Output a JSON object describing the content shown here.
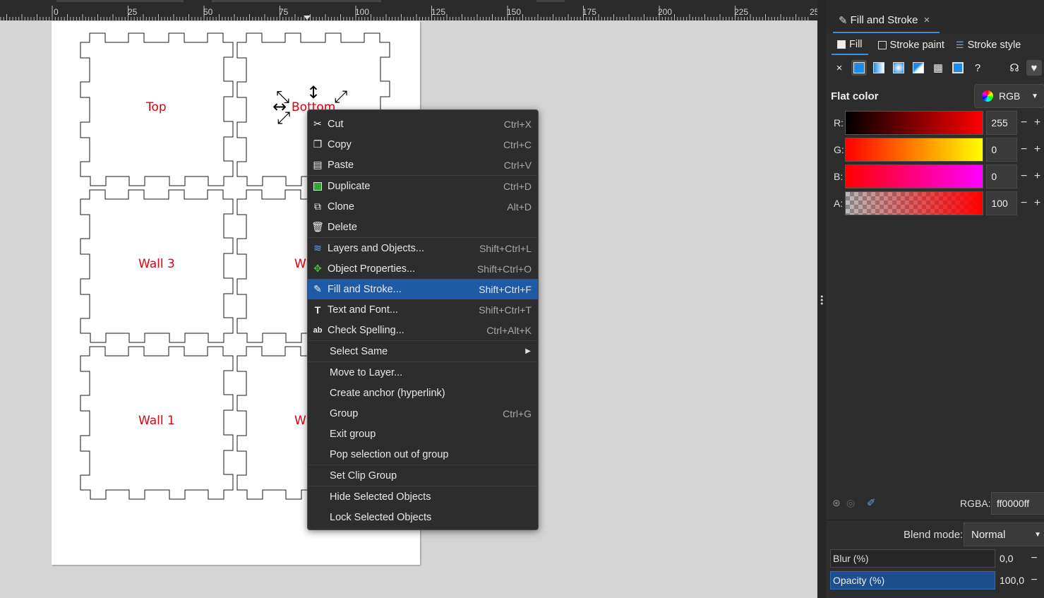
{
  "ruler": {
    "labels": [
      "0",
      "25",
      "50",
      "75",
      "100",
      "125",
      "150",
      "175",
      "200",
      "225",
      "25"
    ]
  },
  "canvas": {
    "labels": {
      "top": "Top",
      "bottom": "Bottom",
      "wall3": "Wall 3",
      "wall4_partial": "W",
      "wall1": "Wall 1",
      "wall2_partial": "W"
    }
  },
  "panel": {
    "tab_title": "Fill and Stroke",
    "tab_close": "×",
    "subtabs": {
      "fill": "Fill",
      "stroke_paint": "Stroke paint",
      "stroke_style": "Stroke style"
    },
    "modes": {
      "none": "×",
      "unknown": "?"
    },
    "flat_color": "Flat color",
    "color_model": "RGB",
    "channels": [
      {
        "name": "R:",
        "value": "255"
      },
      {
        "name": "G:",
        "value": "0"
      },
      {
        "name": "B:",
        "value": "0"
      },
      {
        "name": "A:",
        "value": "100"
      }
    ],
    "minus": "−",
    "plus": "+",
    "rgba_label": "RGBA:",
    "rgba_value": "ff0000ff",
    "blend_label": "Blend mode:",
    "blend_value": "Normal",
    "blur_label": "Blur (%)",
    "blur_value": "0,0",
    "opacity_label": "Opacity (%)",
    "opacity_value": "100,0",
    "colors": {
      "accent": "#3c8fd8",
      "selection": "#1f5aa6",
      "fill_red": "#ff0000"
    }
  },
  "context_menu": {
    "items": [
      {
        "label": "Cut",
        "shortcut": "Ctrl+X"
      },
      {
        "label": "Copy",
        "shortcut": "Ctrl+C"
      },
      {
        "label": "Paste",
        "shortcut": "Ctrl+V"
      },
      {
        "label": "Duplicate",
        "shortcut": "Ctrl+D"
      },
      {
        "label": "Clone",
        "shortcut": "Alt+D"
      },
      {
        "label": "Delete",
        "shortcut": ""
      },
      {
        "label": "Layers and Objects...",
        "shortcut": "Shift+Ctrl+L"
      },
      {
        "label": "Object Properties...",
        "shortcut": "Shift+Ctrl+O"
      },
      {
        "label": "Fill and Stroke...",
        "shortcut": "Shift+Ctrl+F"
      },
      {
        "label": "Text and Font...",
        "shortcut": "Shift+Ctrl+T"
      },
      {
        "label": "Check Spelling...",
        "shortcut": "Ctrl+Alt+K"
      },
      {
        "label": "Select Same",
        "shortcut": ""
      },
      {
        "label": "Move to Layer...",
        "shortcut": ""
      },
      {
        "label": "Create anchor (hyperlink)",
        "shortcut": ""
      },
      {
        "label": "Group",
        "shortcut": "Ctrl+G"
      },
      {
        "label": "Exit group",
        "shortcut": ""
      },
      {
        "label": "Pop selection out of group",
        "shortcut": ""
      },
      {
        "label": "Set Clip Group",
        "shortcut": ""
      },
      {
        "label": "Hide Selected Objects",
        "shortcut": ""
      },
      {
        "label": "Lock Selected Objects",
        "shortcut": ""
      }
    ]
  }
}
